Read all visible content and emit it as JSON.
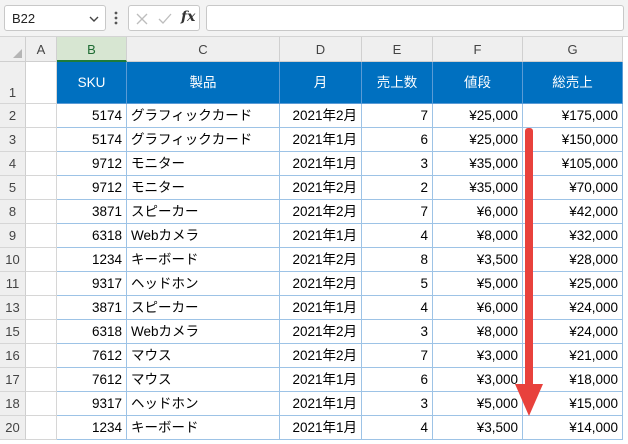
{
  "formula_bar": {
    "name_box": "B22",
    "fx_label": "fx",
    "formula": ""
  },
  "columns": [
    "A",
    "B",
    "C",
    "D",
    "E",
    "F",
    "G"
  ],
  "selected_column": "B",
  "header_row": {
    "row_number": "1",
    "cells": [
      "SKU",
      "製品",
      "月",
      "売上数",
      "値段",
      "総売上"
    ]
  },
  "rows": [
    {
      "row_number": "2",
      "cells": [
        "5174",
        "グラフィックカード",
        "2021年2月",
        "7",
        "¥25,000",
        "¥175,000"
      ]
    },
    {
      "row_number": "3",
      "cells": [
        "5174",
        "グラフィックカード",
        "2021年1月",
        "6",
        "¥25,000",
        "¥150,000"
      ]
    },
    {
      "row_number": "4",
      "cells": [
        "9712",
        "モニター",
        "2021年1月",
        "3",
        "¥35,000",
        "¥105,000"
      ]
    },
    {
      "row_number": "5",
      "cells": [
        "9712",
        "モニター",
        "2021年2月",
        "2",
        "¥35,000",
        "¥70,000"
      ]
    },
    {
      "row_number": "8",
      "cells": [
        "3871",
        "スピーカー",
        "2021年2月",
        "7",
        "¥6,000",
        "¥42,000"
      ]
    },
    {
      "row_number": "9",
      "cells": [
        "6318",
        "Webカメラ",
        "2021年1月",
        "4",
        "¥8,000",
        "¥32,000"
      ]
    },
    {
      "row_number": "10",
      "cells": [
        "1234",
        "キーボード",
        "2021年2月",
        "8",
        "¥3,500",
        "¥28,000"
      ]
    },
    {
      "row_number": "11",
      "cells": [
        "9317",
        "ヘッドホン",
        "2021年2月",
        "5",
        "¥5,000",
        "¥25,000"
      ]
    },
    {
      "row_number": "13",
      "cells": [
        "3871",
        "スピーカー",
        "2021年1月",
        "4",
        "¥6,000",
        "¥24,000"
      ]
    },
    {
      "row_number": "15",
      "cells": [
        "6318",
        "Webカメラ",
        "2021年2月",
        "3",
        "¥8,000",
        "¥24,000"
      ]
    },
    {
      "row_number": "16",
      "cells": [
        "7612",
        "マウス",
        "2021年2月",
        "7",
        "¥3,000",
        "¥21,000"
      ]
    },
    {
      "row_number": "17",
      "cells": [
        "7612",
        "マウス",
        "2021年1月",
        "6",
        "¥3,000",
        "¥18,000"
      ]
    },
    {
      "row_number": "18",
      "cells": [
        "9317",
        "ヘッドホン",
        "2021年1月",
        "3",
        "¥5,000",
        "¥15,000"
      ]
    },
    {
      "row_number": "20",
      "cells": [
        "1234",
        "キーボード",
        "2021年1月",
        "4",
        "¥3,500",
        "¥14,000"
      ]
    }
  ],
  "colors": {
    "header_fill": "#0070c0",
    "arrow": "#e8413c",
    "selected_column": "#1e7b3a"
  },
  "annotation": {
    "type": "sort-descending-arrow",
    "icon": "down-arrow-icon"
  }
}
